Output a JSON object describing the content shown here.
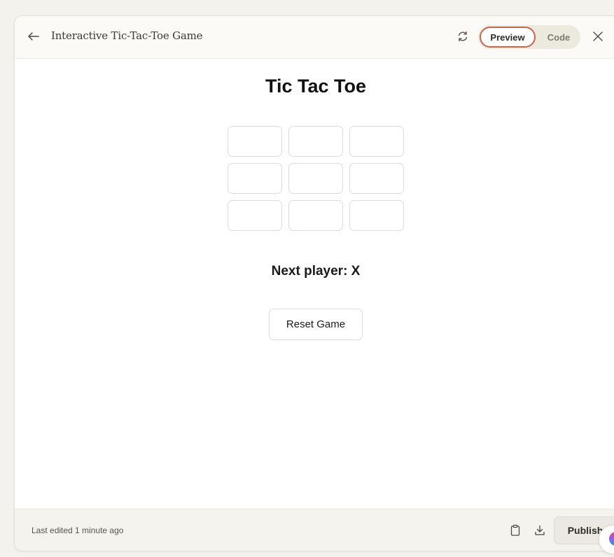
{
  "header": {
    "title": "Interactive Tic-Tac-Toe Game",
    "toggle": {
      "preview_label": "Preview",
      "code_label": "Code",
      "active": "Preview"
    },
    "icons": {
      "back": "arrow-left-icon",
      "refresh": "refresh-icon",
      "close": "close-icon"
    }
  },
  "game": {
    "title": "Tic Tac Toe",
    "board": [
      "",
      "",
      "",
      "",
      "",
      "",
      "",
      "",
      ""
    ],
    "status": "Next player: X",
    "reset_label": "Reset Game"
  },
  "footer": {
    "last_edited": "Last edited 1 minute ago",
    "publish_label": "Publish",
    "icons": {
      "copy": "clipboard-icon",
      "download": "download-icon"
    }
  },
  "colors": {
    "accent": "#c8664a",
    "panel_bg": "#ffffff",
    "page_bg": "#f4f2ec"
  }
}
